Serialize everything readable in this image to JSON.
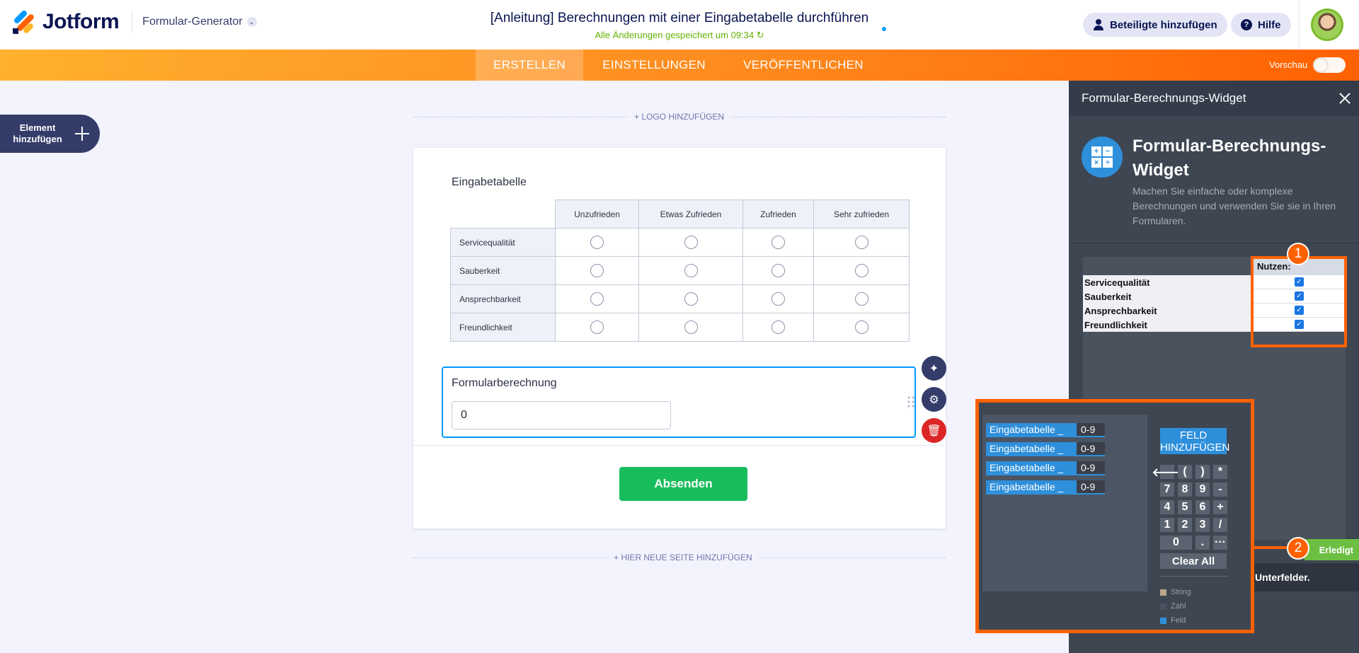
{
  "header": {
    "brand": "Jotform",
    "generator_label": "Formular-Generator",
    "title": "[Anleitung] Berechnungen mit einer Eingabetabelle durchführen",
    "save_status": "Alle Änderungen gespeichert um 09:34 ↻",
    "add_participants": "Beteiligte hinzufügen",
    "help": "Hilfe"
  },
  "tabs": {
    "create": "ERSTELLEN",
    "settings": "EINSTELLUNGEN",
    "publish": "VERÖFFENTLICHEN",
    "preview": "Vorschau"
  },
  "sidebar": {
    "add_element": "Element hinzufügen"
  },
  "canvas": {
    "add_logo": "+ LOGO HINZUFÜGEN",
    "add_page": "+ HIER NEUE SEITE HINZUFÜGEN"
  },
  "form": {
    "matrix_label": "Eingabetabelle",
    "columns": [
      "Unzufrieden",
      "Etwas Zufrieden",
      "Zufrieden",
      "Sehr zufrieden"
    ],
    "rows": [
      "Servicequalität",
      "Sauberkeit",
      "Ansprechbarkeit",
      "Freundlichkeit"
    ],
    "calc_label": "Formularberechnung",
    "calc_value": "0",
    "submit": "Absenden"
  },
  "panel": {
    "title": "Formular-Berechnungs-Widget",
    "widget_name": "Formular-Berechnungs-Widget",
    "widget_desc": "Machen Sie einfache oder komplexe Berechnungen und verwenden Sie sie in Ihren Formularen.",
    "use_header": "Nutzen:",
    "config_rows": [
      "Servicequalität",
      "Sauberkeit",
      "Ansprechbarkeit",
      "Freundlichkeit"
    ],
    "done": "Erledigt",
    "subfields": "Unterfelder.",
    "badge_1": "1",
    "badge_2": "2"
  },
  "builder": {
    "fields": [
      {
        "name": "Eingabetabelle _",
        "range": "0-9"
      },
      {
        "name": "Eingabetabelle _",
        "range": "0-9"
      },
      {
        "name": "Eingabetabelle _",
        "range": "0-9"
      },
      {
        "name": "Eingabetabelle _",
        "range": "0-9"
      }
    ],
    "add_field": "FELD HINZUFÜGEN",
    "keys": [
      "🡐",
      "(",
      ")",
      "*",
      "7",
      "8",
      "9",
      "-",
      "4",
      "5",
      "6",
      "+",
      "1",
      "2",
      "3",
      "/",
      "0",
      ".",
      "···"
    ],
    "clear_all": "Clear All",
    "legend": [
      {
        "label": "String",
        "color": "#b8a68a"
      },
      {
        "label": "Zahl",
        "color": "#4b5161"
      },
      {
        "label": "Feld",
        "color": "#2e8fdb"
      }
    ]
  }
}
